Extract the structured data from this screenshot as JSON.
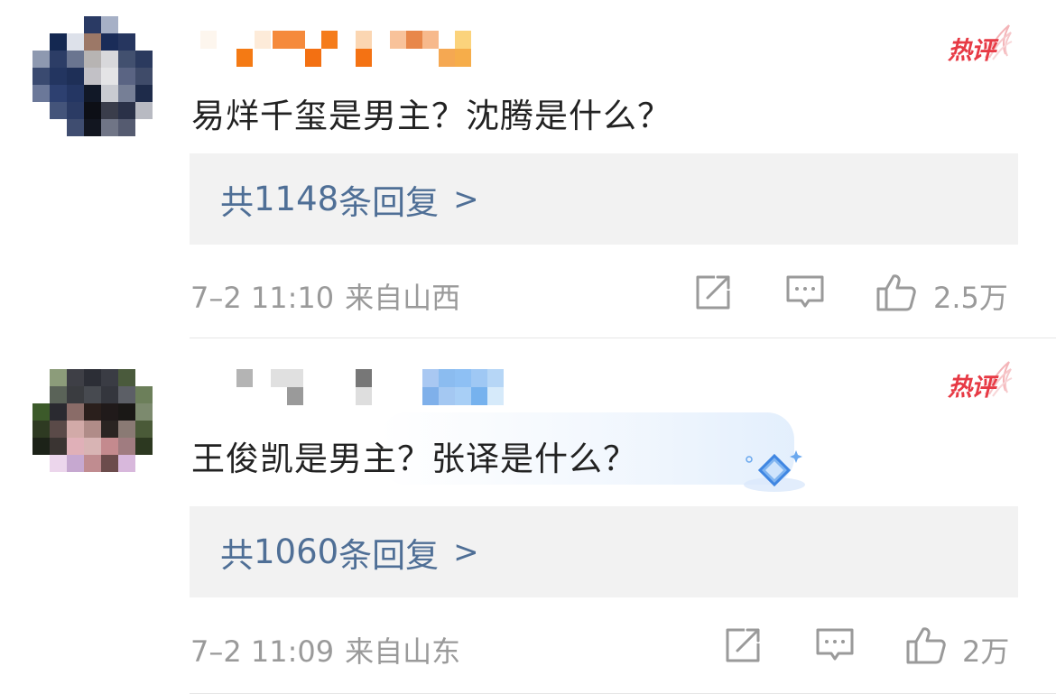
{
  "comments": [
    {
      "text": "易烊千玺是男主？沈腾是什么？",
      "badge": "热评",
      "reply_prefix": "共",
      "reply_count": "1148",
      "reply_suffix": "条回复",
      "reply_chevron": ">",
      "time": "7–2 11:10",
      "location": "来自山西",
      "like_count": "2.5万"
    },
    {
      "text": "王俊凯是男主？张译是什么？",
      "badge": "热评",
      "reply_prefix": "共",
      "reply_count": "1060",
      "reply_suffix": "条回复",
      "reply_chevron": ">",
      "time": "7–2 11:09",
      "location": "来自山东",
      "like_count": "2万"
    }
  ],
  "icons": {
    "repost": "share-square-icon",
    "comment": "comment-bubble-icon",
    "like": "thumbs-up-icon",
    "badge_decor": "flame-wing-icon",
    "diamond_decor": "diamond-sparkle-icon"
  },
  "colors": {
    "comment_text": "#222222",
    "reply_link": "#4f6f96",
    "reply_bg": "#f2f2f2",
    "meta": "#9a9a9a",
    "hot_badge": "#e73a45"
  }
}
